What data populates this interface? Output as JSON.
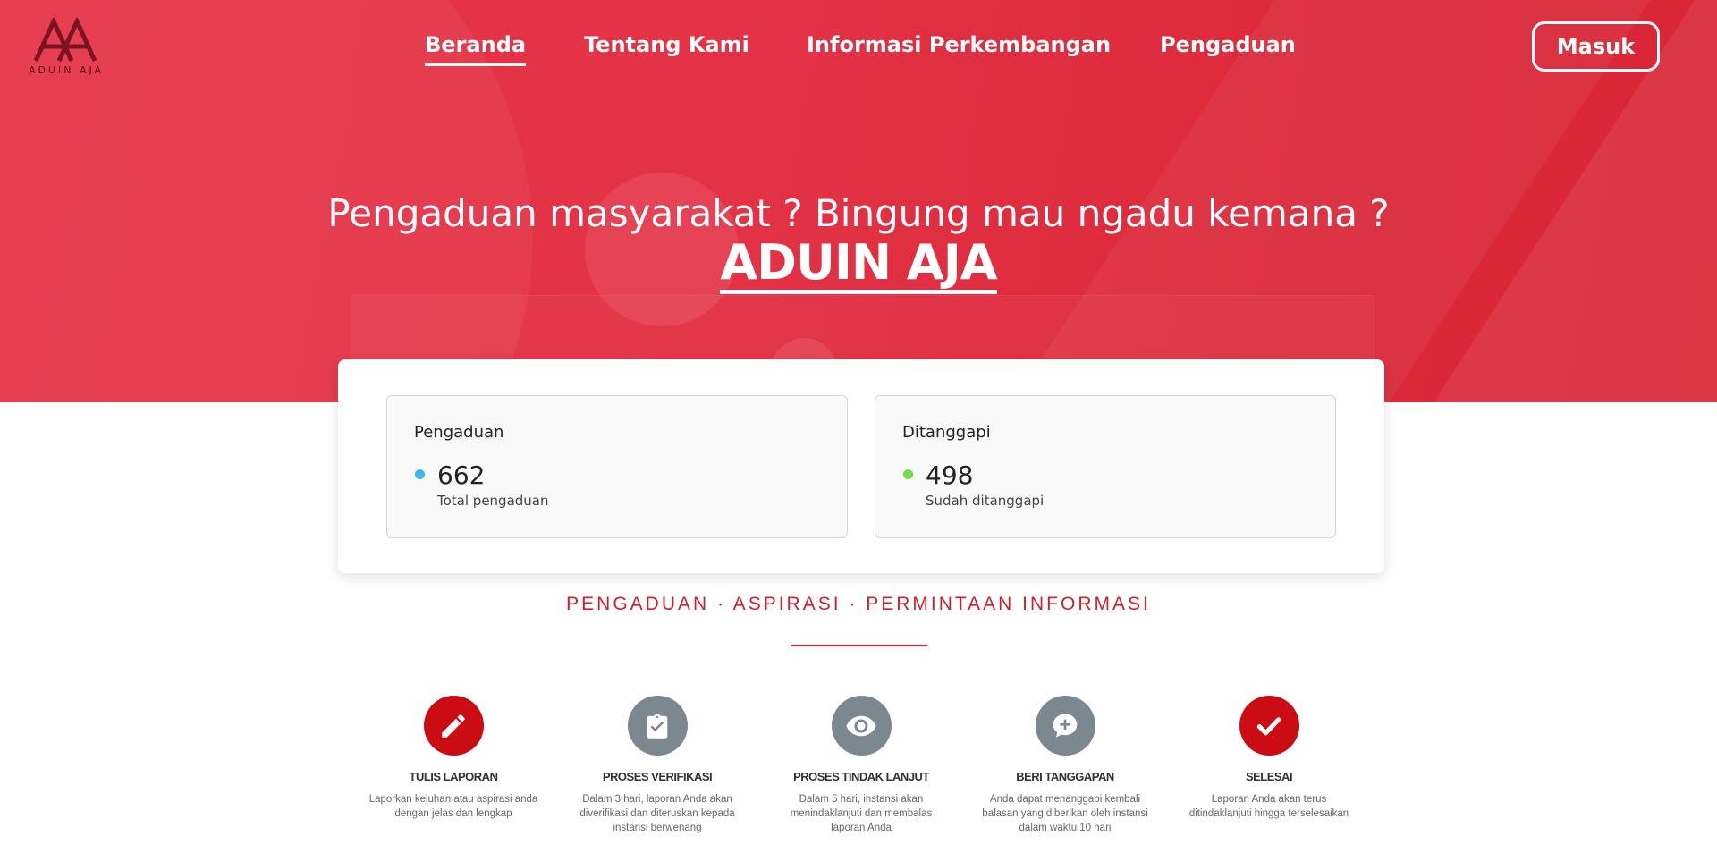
{
  "brand": {
    "logo_text": "ADUIN AJA",
    "primary_color": "#e33145",
    "accent_red": "#cc0c14",
    "step_grey": "#7c8890"
  },
  "nav": {
    "items": [
      {
        "label": "Beranda",
        "active": true
      },
      {
        "label": "Tentang Kami",
        "active": false
      },
      {
        "label": "Informasi Perkembangan",
        "active": false
      },
      {
        "label": "Pengaduan",
        "active": false
      }
    ],
    "login_label": "Masuk"
  },
  "hero": {
    "headline": "Pengaduan masyarakat ? Bingung mau ngadu kemana ?",
    "brand_title": "ADUIN AJA"
  },
  "stats": [
    {
      "title": "Pengaduan",
      "value": "662",
      "caption": "Total pengaduan",
      "dot_color": "#3fb3ef"
    },
    {
      "title": "Ditanggapi",
      "value": "498",
      "caption": "Sudah ditanggapi",
      "dot_color": "#6fdc4c"
    }
  ],
  "tagline": "PENGADUAN · ASPIRASI · PERMINTAAN INFORMASI",
  "steps": [
    {
      "label": "TULIS LAPORAN",
      "description": "Laporkan keluhan atau aspirasi anda dengan jelas dan lengkap",
      "icon": "pencil-icon",
      "color": "red"
    },
    {
      "label": "PROSES VERIFIKASI",
      "description": "Dalam 3 hari, laporan Anda akan diverifikasi dan diteruskan kepada instansi berwenang",
      "icon": "clipboard-check-icon",
      "color": "grey"
    },
    {
      "label": "PROSES TINDAK LANJUT",
      "description": "Dalam 5 hari, instansi akan menindaklanjuti dan membalas laporan Anda",
      "icon": "eye-icon",
      "color": "grey"
    },
    {
      "label": "BERI TANGGAPAN",
      "description": "Anda dapat menanggapi kembali balasan yang diberikan oleh instansi dalam waktu 10 hari",
      "icon": "comment-plus-icon",
      "color": "grey"
    },
    {
      "label": "SELESAI",
      "description": "Laporan Anda akan terus ditindaklanjuti hingga terselesaikan",
      "icon": "check-icon",
      "color": "red"
    }
  ]
}
